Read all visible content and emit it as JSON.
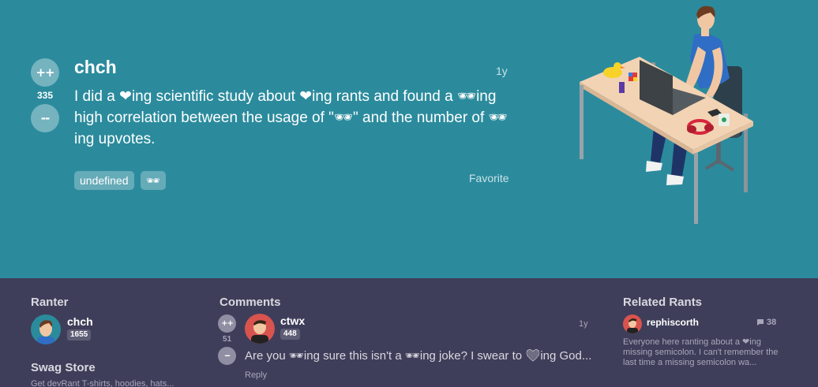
{
  "rant": {
    "upvote_label": "++",
    "downvote_label": "--",
    "score": "335",
    "username": "chch",
    "time": "1y",
    "text": "I did a ❤ing scientific study about ❤ing rants and found a 🕶ing high correlation between the usage of \"🕶\" and the number of 🕶 ing upvotes.",
    "tags": [
      "undefined",
      "🕶"
    ],
    "favorite_label": "Favorite"
  },
  "ranter": {
    "title": "Ranter",
    "username": "chch",
    "score": "1655"
  },
  "swag": {
    "title": "Swag Store",
    "text": "Get devRant T-shirts, hoodies, hats..."
  },
  "comments": {
    "title": "Comments",
    "items": [
      {
        "upvote_label": "++",
        "downvote_label": "--",
        "score": "51",
        "username": "ctwx",
        "user_score": "448",
        "time": "1y",
        "text": "Are you 🕶ing sure this isn't a 🕶ing joke? I swear to ❤ing God...",
        "reply_label": "Reply"
      }
    ]
  },
  "related": {
    "title": "Related Rants",
    "items": [
      {
        "username": "rephiscorth",
        "comment_count": "38",
        "text": "Everyone here ranting about a ❤ing missing semicolon. I can't remember the last time a missing semicolon wa..."
      }
    ]
  },
  "colors": {
    "hero_bg": "#2b8b9d",
    "footer_bg": "#3f3e5a"
  }
}
